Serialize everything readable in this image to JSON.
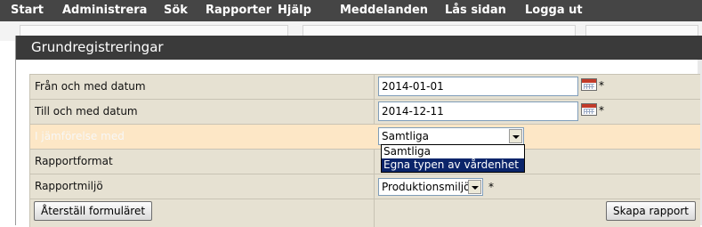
{
  "menu": {
    "items": [
      "Start",
      "Administrera",
      "Sök",
      "Rapporter",
      "Hjälp",
      "Meddelanden",
      "Lås sidan",
      "Logga ut"
    ]
  },
  "dialog": {
    "title": "Grundregistreringar"
  },
  "form": {
    "from_date": {
      "label": "Från och med datum",
      "value": "2014-01-01",
      "required": "*"
    },
    "to_date": {
      "label": "Till och med datum",
      "value": "2014-12-11",
      "required": "*"
    },
    "compare": {
      "label": "I jämförelse med",
      "value": "Samtliga",
      "options": [
        "Samtliga",
        "Egna typen av vårdenhet"
      ],
      "highlighted_option": "Egna typen av vårdenhet"
    },
    "report_format": {
      "label": "Rapportformat"
    },
    "report_env": {
      "label": "Rapportmiljö",
      "value": "Produktionsmiljö",
      "required": "*"
    },
    "reset_label": "Återställ formuläret",
    "create_label": "Skapa rapport"
  },
  "colors": {
    "menu_bg": "#454545",
    "title_bg": "#3a3a3a",
    "form_bg": "#e6e1d2",
    "highlight_row": "#fde7c6",
    "selected_option": "#0a246a"
  }
}
